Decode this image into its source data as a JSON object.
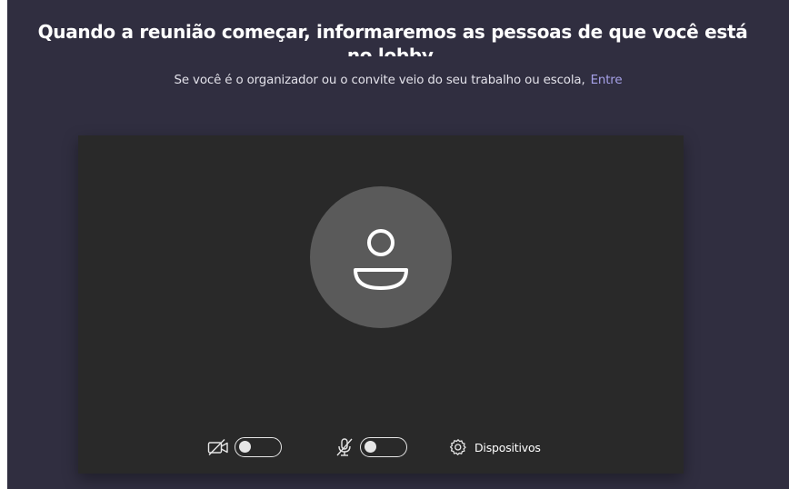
{
  "header": {
    "title": "Quando a reunião começar, informaremos as pessoas de que você está no lobby.",
    "subtitle_text": "Se você é o organizador ou o convite veio do seu trabalho ou escola,",
    "signin_link": "Entre"
  },
  "preview": {
    "avatar_icon": "person-icon",
    "camera_toggle": {
      "icon": "camera-off-icon",
      "state": "off"
    },
    "mic_toggle": {
      "icon": "mic-off-icon",
      "state": "off"
    },
    "devices": {
      "icon": "gear-icon",
      "label": "Dispositivos"
    }
  },
  "colors": {
    "background": "#302e40",
    "preview_background": "#292929",
    "avatar_circle": "#5a5a5a",
    "link": "#a6a1e8"
  }
}
